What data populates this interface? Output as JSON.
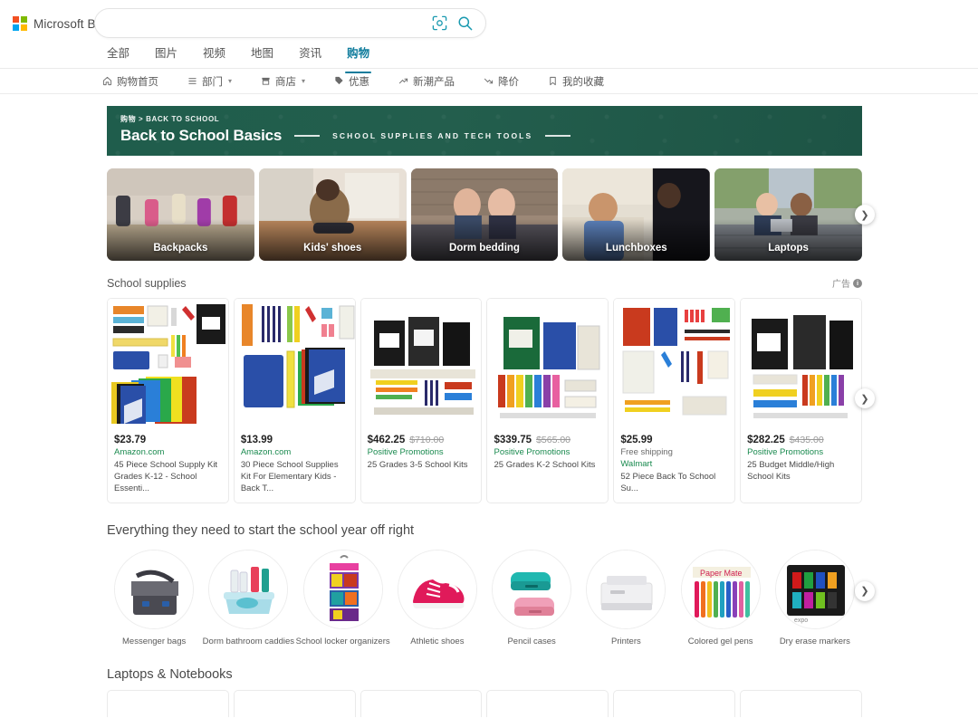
{
  "header": {
    "logo_text": "Microsoft Bing",
    "search_value": "",
    "search_placeholder": "",
    "visual_search_icon": "camera-lens-icon",
    "search_icon": "magnifier-icon",
    "tabs": [
      {
        "label": "全部",
        "active": false
      },
      {
        "label": "图片",
        "active": false
      },
      {
        "label": "视频",
        "active": false
      },
      {
        "label": "地图",
        "active": false
      },
      {
        "label": "资讯",
        "active": false
      },
      {
        "label": "购物",
        "active": true
      }
    ]
  },
  "subnav": [
    {
      "label": "购物首页",
      "icon": "home-icon",
      "caret": false
    },
    {
      "label": "部门",
      "icon": "list-icon",
      "caret": true
    },
    {
      "label": "商店",
      "icon": "store-icon",
      "caret": true
    },
    {
      "label": "优惠",
      "icon": "tag-icon",
      "caret": false
    },
    {
      "label": "新潮产品",
      "icon": "trending-up-icon",
      "caret": false
    },
    {
      "label": "降价",
      "icon": "trending-down-icon",
      "caret": false
    },
    {
      "label": "我的收藏",
      "icon": "bookmark-icon",
      "caret": false
    }
  ],
  "banner": {
    "breadcrumb": "购物 > BACK TO SCHOOL",
    "title": "Back to School Basics",
    "subtitle": "SCHOOL SUPPLIES AND TECH TOOLS",
    "color": "#1f5d4c"
  },
  "tiles": [
    {
      "label": "Backpacks"
    },
    {
      "label": "Kids' shoes"
    },
    {
      "label": "Dorm bedding"
    },
    {
      "label": "Lunchboxes"
    },
    {
      "label": "Laptops"
    }
  ],
  "school_supplies": {
    "section_title": "School supplies",
    "ads_label": "广告",
    "ads_info": "i",
    "products": [
      {
        "price": "$23.79",
        "old_price": "",
        "shipping": "",
        "merchant": "Amazon.com",
        "description": "45 Piece School Supply Kit Grades K-12 - School Essenti..."
      },
      {
        "price": "$13.99",
        "old_price": "",
        "shipping": "",
        "merchant": "Amazon.com",
        "description": "30 Piece School Supplies Kit For Elementary Kids - Back T..."
      },
      {
        "price": "$462.25",
        "old_price": "$710.00",
        "shipping": "",
        "merchant": "Positive Promotions",
        "description": "25 Grades 3-5 School Kits"
      },
      {
        "price": "$339.75",
        "old_price": "$565.00",
        "shipping": "",
        "merchant": "Positive Promotions",
        "description": "25 Grades K-2 School Kits"
      },
      {
        "price": "$25.99",
        "old_price": "",
        "shipping": "Free shipping",
        "merchant": "Walmart",
        "description": "52 Piece Back To School Su..."
      },
      {
        "price": "$282.25",
        "old_price": "$435.00",
        "shipping": "",
        "merchant": "Positive Promotions",
        "description": "25 Budget Middle/High School Kits"
      }
    ]
  },
  "everything_section": {
    "title": "Everything they need to start the school year off right",
    "items": [
      {
        "label": "Messenger bags"
      },
      {
        "label": "Dorm bathroom caddies"
      },
      {
        "label": "School locker organizers"
      },
      {
        "label": "Athletic shoes"
      },
      {
        "label": "Pencil cases"
      },
      {
        "label": "Printers"
      },
      {
        "label": "Colored gel pens"
      },
      {
        "label": "Dry erase markers"
      }
    ]
  },
  "bottom_section": {
    "title": "Laptops & Notebooks"
  },
  "carousel": {
    "next_arrow": "chevron-right-icon"
  }
}
